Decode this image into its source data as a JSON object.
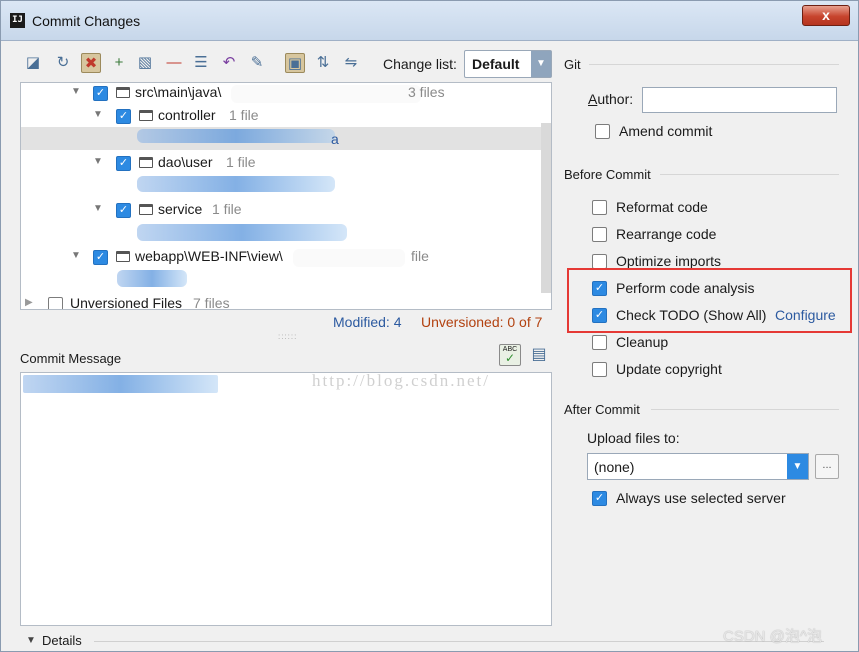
{
  "window": {
    "title": "Commit Changes",
    "close_label": "x"
  },
  "toolbar": {
    "icons": [
      "vcs-icon",
      "refresh-icon",
      "diff-icon",
      "add-icon",
      "move-icon",
      "remove-icon",
      "group-icon",
      "revert-icon",
      "edit-icon",
      "show-module-icon",
      "expand-all-icon",
      "collapse-all-icon"
    ],
    "change_list_label": "Change list:",
    "change_list_value": "Default"
  },
  "tree": {
    "rows": [
      {
        "label": "src\\main\\java\\",
        "count": "3 files",
        "checked": true
      },
      {
        "label": "controller",
        "count": "1 file",
        "checked": true
      },
      {
        "label": "a"
      },
      {
        "label": "dao\\user",
        "count": "1 file",
        "checked": true
      },
      {
        "label": "service",
        "count": "1 file",
        "checked": true
      },
      {
        "label": "webapp\\WEB-INF\\view\\",
        "count": "file",
        "checked": true
      },
      {
        "label": "Unversioned Files",
        "count": "7 files",
        "checked": false
      }
    ]
  },
  "status": {
    "modified": "Modified: 4",
    "unversioned": "Unversioned: 0 of 7"
  },
  "commit_message": {
    "label": "Commit Message",
    "icon_text": "ABC"
  },
  "watermark": "http://blog.csdn.net/",
  "details": {
    "label": "Details"
  },
  "git": {
    "title": "Git",
    "author_label": "Author:",
    "author_value": "",
    "amend_label": "Amend commit",
    "amend_checked": false
  },
  "before_commit": {
    "title": "Before Commit",
    "options": [
      {
        "label": "Reformat code",
        "checked": false
      },
      {
        "label": "Rearrange code",
        "checked": false
      },
      {
        "label": "Optimize imports",
        "checked": false
      },
      {
        "label": "Perform code analysis",
        "checked": true
      },
      {
        "label": "Check TODO (Show All)",
        "checked": true
      },
      {
        "label": "Cleanup",
        "checked": false
      },
      {
        "label": "Update copyright",
        "checked": false
      }
    ],
    "configure_label": "Configure"
  },
  "after_commit": {
    "title": "After Commit",
    "upload_label": "Upload files to:",
    "upload_value": "(none)",
    "browse_label": "...",
    "always_use_label": "Always use selected server",
    "always_use_checked": true
  },
  "csdn_mark": "CSDN @泡^泡"
}
